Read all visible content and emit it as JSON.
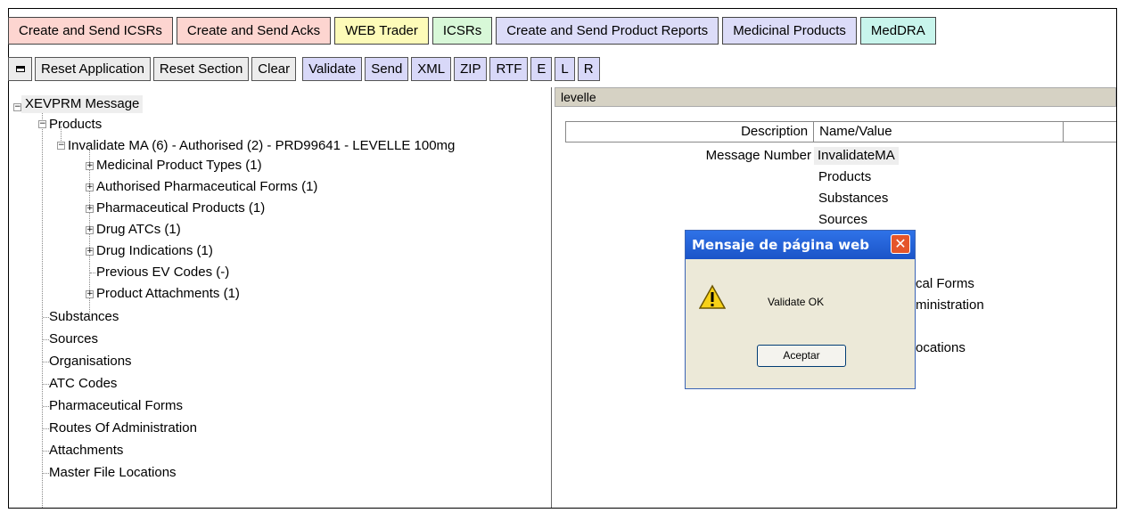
{
  "tabs": [
    {
      "label": "Create and Send ICSRs",
      "color": "#fdd5d0"
    },
    {
      "label": "Create and Send Acks",
      "color": "#fdd5d0"
    },
    {
      "label": "WEB Trader",
      "color": "#fdfbb8"
    },
    {
      "label": "ICSRs",
      "color": "#d8f8d8"
    },
    {
      "label": "Create and Send Product Reports",
      "color": "#dcdcf8"
    },
    {
      "label": "Medicinal Products",
      "color": "#dcdcf8"
    },
    {
      "label": "MedDRA",
      "color": "#c8f5ec"
    }
  ],
  "toolbar": {
    "reset_app": "Reset Application",
    "reset_section": "Reset Section",
    "clear": "Clear",
    "validate": "Validate",
    "send": "Send",
    "xml": "XML",
    "zip": "ZIP",
    "rtf": "RTF",
    "e": "E",
    "l": "L",
    "r": "R"
  },
  "tree": {
    "root": "XEVPRM Message",
    "products": "Products",
    "product_item": "Invalidate MA (6) - Authorised (2) - PRD99641 - LEVELLE 100mg",
    "children": [
      "Medicinal Product Types (1)",
      "Authorised Pharmaceutical Forms (1)",
      "Pharmaceutical Products (1)",
      "Drug ATCs (1)",
      "Drug Indications (1)",
      "Previous EV Codes (-)",
      "Product Attachments (1)"
    ],
    "sections": [
      "Substances",
      "Sources",
      "Organisations",
      "ATC Codes",
      "Pharmaceutical Forms",
      "Routes Of Administration",
      "Attachments",
      "Master File Locations"
    ]
  },
  "right": {
    "header": "levelle",
    "col_description": "Description",
    "col_value": "Name/Value",
    "message_number_label": "Message Number",
    "message_number_value": "InvalidateMA",
    "values": [
      "Products",
      "Substances",
      "Sources"
    ],
    "partial_1": "cal Forms",
    "partial_2": "ministration",
    "partial_3": "ocations"
  },
  "dialog": {
    "title": "Mensaje de página web",
    "message": "Validate OK",
    "ok": "Aceptar"
  }
}
